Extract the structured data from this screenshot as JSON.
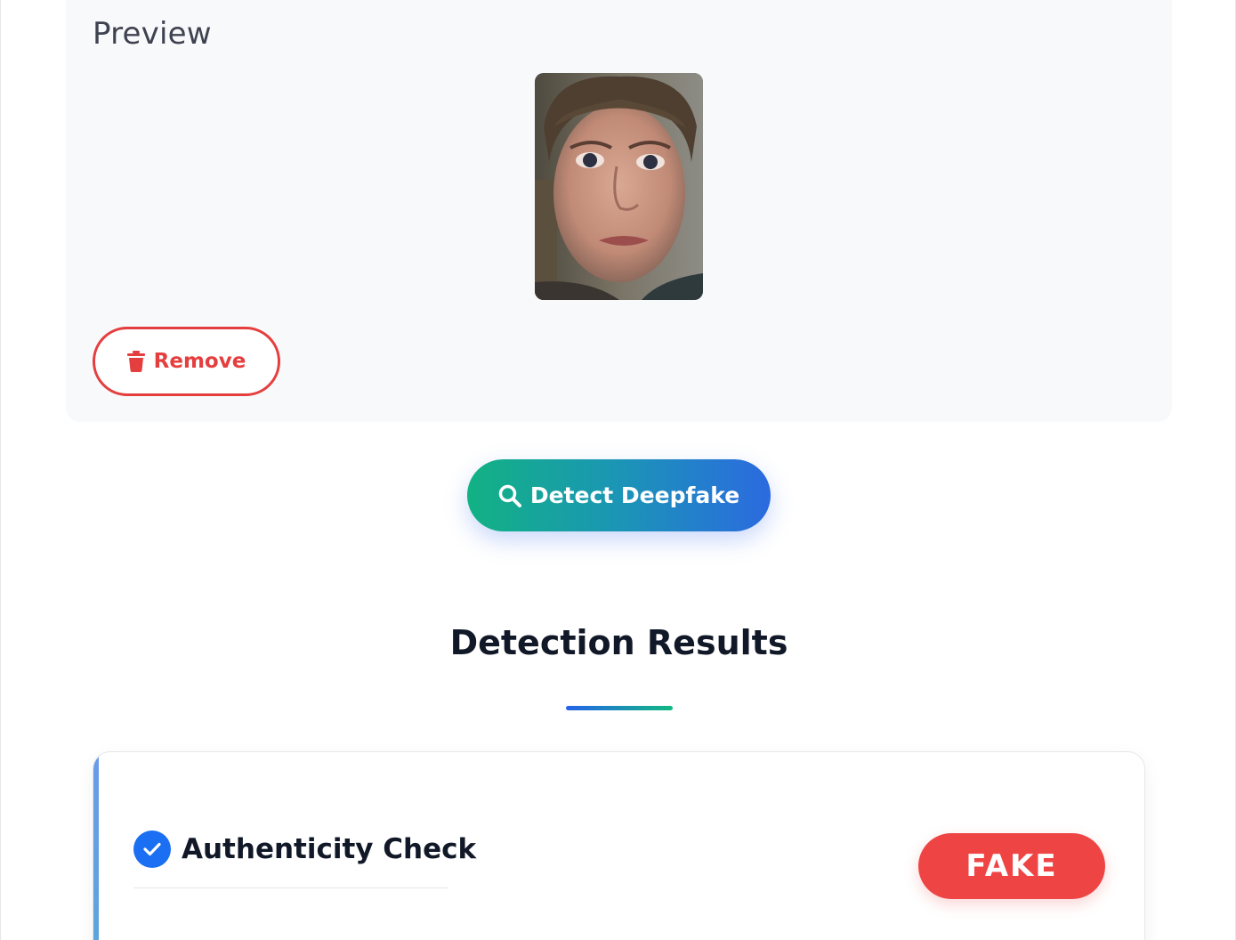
{
  "preview": {
    "title": "Preview",
    "image_alt": "face-photo",
    "remove_label": "Remove",
    "remove_icon": "trash-icon"
  },
  "actions": {
    "detect_label": "Detect Deepfake",
    "detect_icon": "search-icon"
  },
  "results": {
    "title": "Detection Results",
    "card": {
      "check_title": "Authenticity Check",
      "check_icon": "check-circle-icon",
      "verdict": "FAKE"
    }
  },
  "colors": {
    "danger": "#ef4444",
    "primary_blue": "#1a6ff2",
    "gradient_start": "#12b283",
    "gradient_end": "#2b6ae0",
    "title_text": "#111827"
  }
}
